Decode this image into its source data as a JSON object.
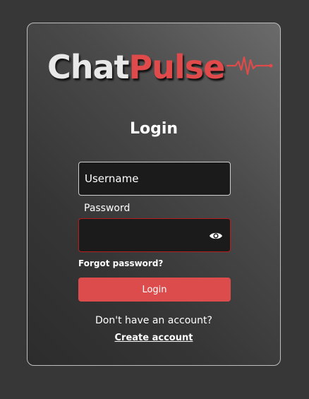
{
  "logo": {
    "part1": "Chat",
    "part2": "Pulse",
    "icon": "pulse-wave-icon"
  },
  "login": {
    "title": "Login",
    "username_placeholder": "Username",
    "password_label": "Password",
    "password_value": "",
    "toggle_visibility_icon": "eye-icon",
    "forgot_password": "Forgot password?",
    "login_button": "Login",
    "no_account_text": "Don't have an account?",
    "create_account_link": "Create account"
  },
  "colors": {
    "accent": "#dc4c4c",
    "error_border": "#b81e1e",
    "card_border": "#bfbfbf",
    "page_background": "#373737"
  }
}
